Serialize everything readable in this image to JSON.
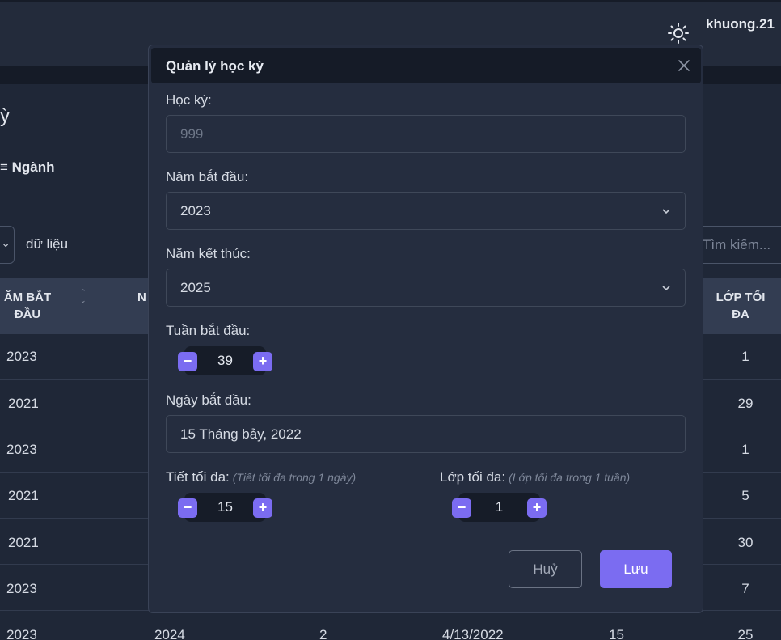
{
  "header": {
    "username": "khuong.21"
  },
  "page": {
    "title_fragment": "ỳ",
    "filter_label": "≡ Ngành",
    "show_text": "dữ liệu",
    "search_placeholder": "Tìm kiếm..."
  },
  "table": {
    "headers": [
      "ĂM BẮT ĐẦU",
      "N",
      "LỚP TỐI ĐA"
    ],
    "rows": [
      {
        "col1": "2023",
        "last": "1"
      },
      {
        "col1": "2021",
        "last": "29"
      },
      {
        "col1": "2023",
        "last": "1"
      },
      {
        "col1": "2021",
        "last": "5"
      },
      {
        "col1": "2021",
        "last": "30"
      },
      {
        "col1": "2023",
        "last": "7"
      },
      {
        "col1": "2023",
        "col2": "2024",
        "col3": "2",
        "col4": "4/13/2022",
        "col5": "15",
        "last": "25"
      }
    ]
  },
  "modal": {
    "title": "Quản lý học kỳ",
    "hoc_ky_label": "Học kỳ:",
    "hoc_ky_placeholder": "999",
    "nam_bat_dau_label": "Năm bắt đầu:",
    "nam_bat_dau_value": "2023",
    "nam_ket_thuc_label": "Năm kết thúc:",
    "nam_ket_thuc_value": "2025",
    "tuan_bat_dau_label": "Tuần bắt đầu:",
    "tuan_bat_dau_value": "39",
    "ngay_bat_dau_label": "Ngày bắt đầu:",
    "ngay_bat_dau_value": "15 Tháng bảy, 2022",
    "tiet_toi_da_label": "Tiết tối đa:",
    "tiet_toi_da_hint": "(Tiết tối đa trong 1 ngày)",
    "tiet_toi_da_value": "15",
    "lop_toi_da_label": "Lớp tối đa:",
    "lop_toi_da_hint": "(Lớp tối đa trong 1 tuần)",
    "lop_toi_da_value": "1",
    "cancel_label": "Huỷ",
    "save_label": "Lưu",
    "minus_symbol": "−",
    "plus_symbol": "+"
  },
  "colors": {
    "accent": "#7b6cf1",
    "background": "#1f2737",
    "modal": "#252d3f"
  }
}
